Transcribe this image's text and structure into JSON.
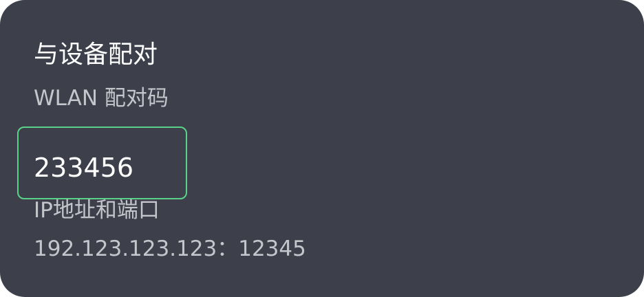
{
  "dialog": {
    "title": "与设备配对",
    "pairing_code_label": "WLAN 配对码",
    "pairing_code": "233456",
    "ip_port_label": "IP地址和端口",
    "ip_port_value": "192.123.123.123：12345"
  },
  "colors": {
    "background": "#3d404b",
    "focus_border": "#5ad38a",
    "primary_text": "#ffffff",
    "secondary_text": "#c4c6cc"
  }
}
